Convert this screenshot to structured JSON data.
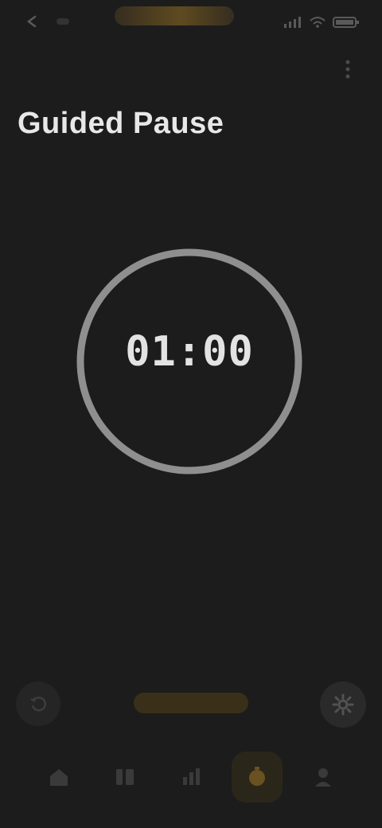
{
  "app": {
    "title": "Guided Pause"
  },
  "status_bar": {
    "left_icons": [
      "back-arrow-icon",
      "notification-icon"
    ],
    "right_icons": [
      "signal-icon",
      "wifi-icon",
      "battery-icon"
    ],
    "accent_color": "#c9a23d"
  },
  "header": {
    "menu_icon": "more-vertical-icon"
  },
  "timer": {
    "value": "01:00",
    "ring_color": "#9a9a9a"
  },
  "controls": {
    "left_icon": "reset-icon",
    "start_label": "",
    "right_icon": "settings-icon"
  },
  "bottom_nav": {
    "items": [
      {
        "icon": "home-icon"
      },
      {
        "icon": "library-icon"
      },
      {
        "icon": "stats-icon"
      },
      {
        "icon": "timer-icon",
        "active": true
      },
      {
        "icon": "profile-icon"
      }
    ],
    "active_color": "#c9a23d"
  }
}
